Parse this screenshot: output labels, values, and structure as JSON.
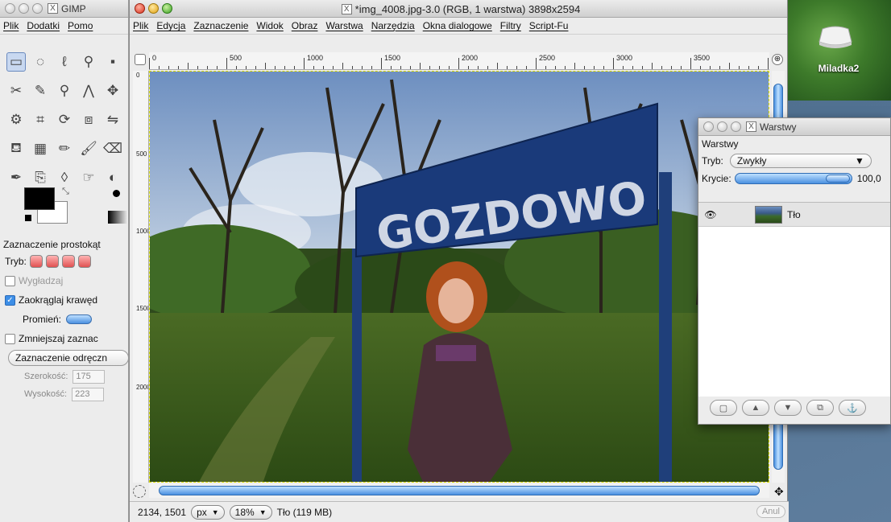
{
  "desktop": {
    "drive_label": "Miladka2"
  },
  "toolbox": {
    "title": "GIMP",
    "menu": [
      "Plik",
      "Dodatki",
      "Pomo"
    ],
    "options": {
      "title": "Zaznaczenie prostokąt",
      "mode_label": "Tryb:",
      "antialias_label": "Wygładzaj",
      "round_corners_label": "Zaokrąglaj krawęd",
      "radius_label": "Promień:",
      "shrink_label": "Zmniejszaj zaznac",
      "fixed_label": "Zaznaczenie odręczn",
      "width_label": "Szerokość:",
      "width_value": "175",
      "height_label": "Wysokość:",
      "height_value": "223"
    }
  },
  "image_window": {
    "title": "*img_4008.jpg-3.0 (RGB, 1 warstwa) 3898x2594",
    "menu": [
      "Plik",
      "Edycja",
      "Zaznaczenie",
      "Widok",
      "Obraz",
      "Warstwa",
      "Narzędzia",
      "Okna dialogowe",
      "Filtry",
      "Script-Fu"
    ],
    "ruler_labels": [
      "0",
      "500",
      "1000",
      "1500",
      "2000",
      "2500",
      "3000",
      "3500"
    ],
    "ruler_v_labels": [
      "0",
      "500",
      "1000",
      "1500",
      "2000"
    ],
    "sign_text": "GOZDOWO",
    "status": {
      "coords": "2134, 1501",
      "unit": "px",
      "zoom": "18%",
      "info": "Tło (119 MB)",
      "cancel": "Anul"
    }
  },
  "layers_dialog": {
    "title": "Warstwy",
    "header": "Warstwy",
    "mode_label": "Tryb:",
    "mode_value": "Zwykły",
    "opacity_label": "Krycie:",
    "opacity_value": "100,0",
    "layers": [
      {
        "name": "Tło",
        "visible": true
      }
    ]
  },
  "colors": {
    "accent": "#4a90e0",
    "sign_blue": "#1a3a7a"
  }
}
